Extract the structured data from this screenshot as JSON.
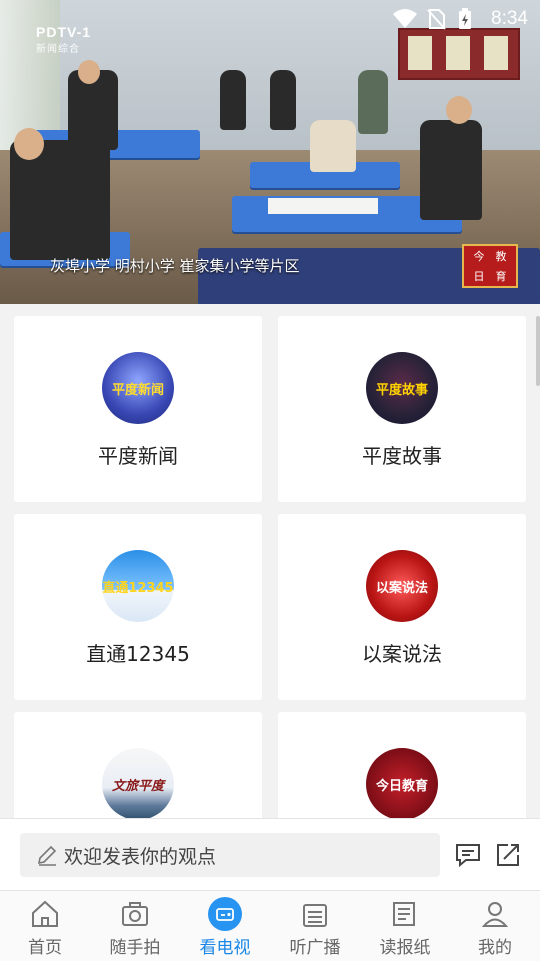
{
  "status": {
    "time": "8:34"
  },
  "video": {
    "channel_logo": "PDTV-1",
    "channel_sub": "新闻综合",
    "caption": "灰埠小学  明村小学  崔家集小学等片区",
    "program_logo": [
      "今",
      "教",
      "日",
      "育"
    ]
  },
  "grid": [
    {
      "label": "平度新闻",
      "thumb_text": "平度新闻"
    },
    {
      "label": "平度故事",
      "thumb_text": "平度故事"
    },
    {
      "label": "直通12345",
      "thumb_text": "直通12345"
    },
    {
      "label": "以案说法",
      "thumb_text": "以案说法"
    },
    {
      "label": "",
      "thumb_text": "文旅平度"
    },
    {
      "label": "",
      "thumb_text": "今日教育"
    }
  ],
  "comment": {
    "placeholder": "欢迎发表你的观点"
  },
  "nav": [
    {
      "label": "首页",
      "icon": "home-icon",
      "active": false
    },
    {
      "label": "随手拍",
      "icon": "camera-icon",
      "active": false
    },
    {
      "label": "看电视",
      "icon": "tv-icon",
      "active": true
    },
    {
      "label": "听广播",
      "icon": "radio-icon",
      "active": false
    },
    {
      "label": "读报纸",
      "icon": "newspaper-icon",
      "active": false
    },
    {
      "label": "我的",
      "icon": "profile-icon",
      "active": false
    }
  ],
  "colors": {
    "accent": "#1a87e6"
  }
}
